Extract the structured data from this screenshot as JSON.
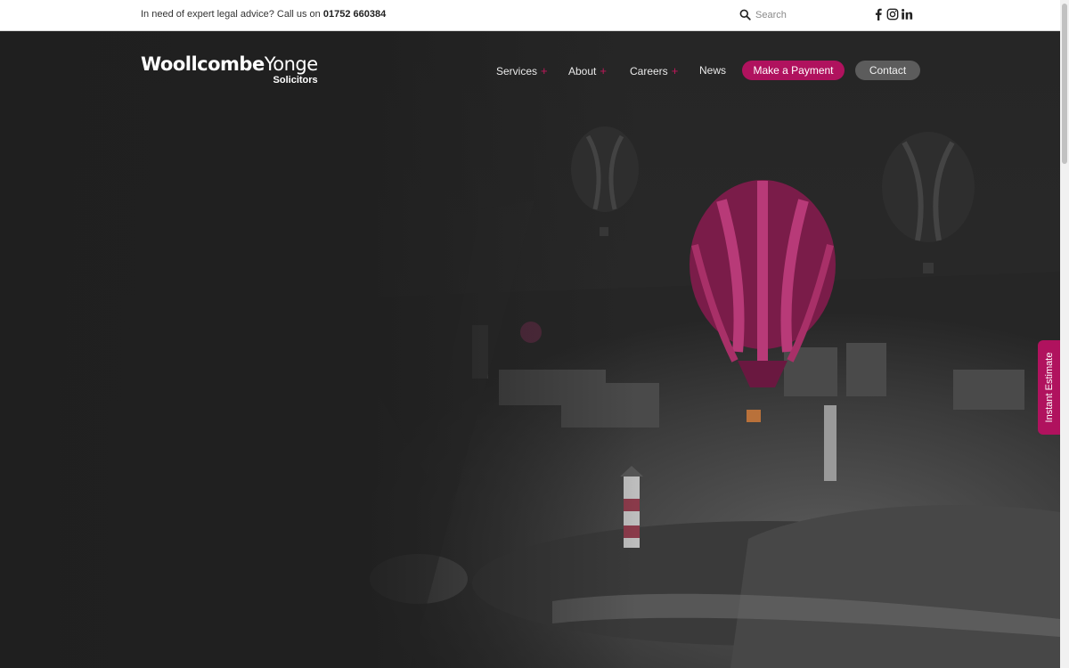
{
  "topbar": {
    "advice_text": "In need of expert legal advice? Call us on ",
    "phone": "01752 660384",
    "search_placeholder": "Search"
  },
  "social": [
    "facebook-icon",
    "instagram-icon",
    "linkedin-icon"
  ],
  "logo": {
    "part1": "Woollcombe",
    "part2": "Yonge",
    "sub": "Solicitors"
  },
  "nav": {
    "services": "Services",
    "about": "About",
    "careers": "Careers",
    "news": "News",
    "plus": "+",
    "make_payment": "Make a Payment",
    "contact": "Contact"
  },
  "side_tab": {
    "label": "Instant Estimate"
  },
  "colors": {
    "accent": "#b0125e",
    "hero_bg": "#232323",
    "contact_btn": "#5c5c5c"
  }
}
